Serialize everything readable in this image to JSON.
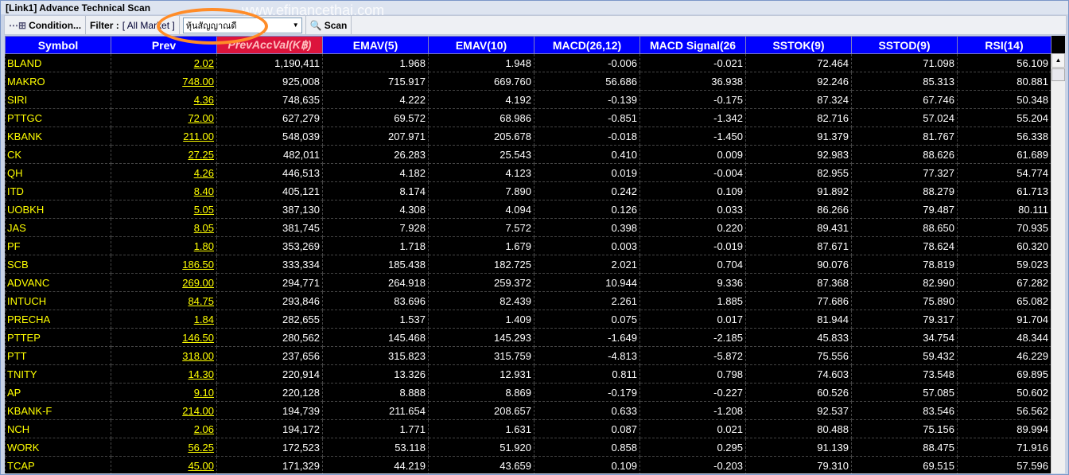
{
  "window": {
    "title": "[Link1] Advance Technical Scan",
    "watermark": "www.efinancethai.com"
  },
  "toolbar": {
    "condition_label": "Condition...",
    "filter_label": "Filter :",
    "filter_value": "[ All Market ]",
    "combo_value": "หุ้นสัญญาณดี",
    "scan_label": "Scan"
  },
  "colors": {
    "header": "#0000ff",
    "sorted_header": "#dc143c",
    "symbol": "#ffff00",
    "annotation": "#ff8c28"
  },
  "columns": [
    "Symbol",
    "Prev",
    "PrevAccVal(K฿)",
    "EMAV(5)",
    "EMAV(10)",
    "MACD(26,12)",
    "MACD Signal(26",
    "SSTOK(9)",
    "SSTOD(9)",
    "RSI(14)"
  ],
  "rows": [
    [
      "BLAND",
      "2.02",
      "1,190,411",
      "1.968",
      "1.948",
      "-0.006",
      "-0.021",
      "72.464",
      "71.098",
      "56.109"
    ],
    [
      "MAKRO",
      "748.00",
      "925,008",
      "715.917",
      "669.760",
      "56.686",
      "36.938",
      "92.246",
      "85.313",
      "80.881"
    ],
    [
      "SIRI",
      "4.36",
      "748,635",
      "4.222",
      "4.192",
      "-0.139",
      "-0.175",
      "87.324",
      "67.746",
      "50.348"
    ],
    [
      "PTTGC",
      "72.00",
      "627,279",
      "69.572",
      "68.986",
      "-0.851",
      "-1.342",
      "82.716",
      "57.024",
      "55.204"
    ],
    [
      "KBANK",
      "211.00",
      "548,039",
      "207.971",
      "205.678",
      "-0.018",
      "-1.450",
      "91.379",
      "81.767",
      "56.338"
    ],
    [
      "CK",
      "27.25",
      "482,011",
      "26.283",
      "25.543",
      "0.410",
      "0.009",
      "92.983",
      "88.626",
      "61.689"
    ],
    [
      "QH",
      "4.26",
      "446,513",
      "4.182",
      "4.123",
      "0.019",
      "-0.004",
      "82.955",
      "77.327",
      "54.774"
    ],
    [
      "ITD",
      "8.40",
      "405,121",
      "8.174",
      "7.890",
      "0.242",
      "0.109",
      "91.892",
      "88.279",
      "61.713"
    ],
    [
      "UOBKH",
      "5.05",
      "387,130",
      "4.308",
      "4.094",
      "0.126",
      "0.033",
      "86.266",
      "79.487",
      "80.111"
    ],
    [
      "JAS",
      "8.05",
      "381,745",
      "7.928",
      "7.572",
      "0.398",
      "0.220",
      "89.431",
      "88.650",
      "70.935"
    ],
    [
      "PF",
      "1.80",
      "353,269",
      "1.718",
      "1.679",
      "0.003",
      "-0.019",
      "87.671",
      "78.624",
      "60.320"
    ],
    [
      "SCB",
      "186.50",
      "333,334",
      "185.438",
      "182.725",
      "2.021",
      "0.704",
      "90.076",
      "78.819",
      "59.023"
    ],
    [
      "ADVANC",
      "269.00",
      "294,771",
      "264.918",
      "259.372",
      "10.944",
      "9.336",
      "87.368",
      "82.990",
      "67.282"
    ],
    [
      "INTUCH",
      "84.75",
      "293,846",
      "83.696",
      "82.439",
      "2.261",
      "1.885",
      "77.686",
      "75.890",
      "65.082"
    ],
    [
      "PRECHA",
      "1.84",
      "282,655",
      "1.537",
      "1.409",
      "0.075",
      "0.017",
      "81.944",
      "79.317",
      "91.704"
    ],
    [
      "PTTEP",
      "146.50",
      "280,562",
      "145.468",
      "145.293",
      "-1.649",
      "-2.185",
      "45.833",
      "34.754",
      "48.344"
    ],
    [
      "PTT",
      "318.00",
      "237,656",
      "315.823",
      "315.759",
      "-4.813",
      "-5.872",
      "75.556",
      "59.432",
      "46.229"
    ],
    [
      "TNITY",
      "14.30",
      "220,914",
      "13.326",
      "12.931",
      "0.811",
      "0.798",
      "74.603",
      "73.548",
      "69.895"
    ],
    [
      "AP",
      "9.10",
      "220,128",
      "8.888",
      "8.869",
      "-0.179",
      "-0.227",
      "60.526",
      "57.085",
      "50.602"
    ],
    [
      "KBANK-F",
      "214.00",
      "194,739",
      "211.654",
      "208.657",
      "0.633",
      "-1.208",
      "92.537",
      "83.546",
      "56.562"
    ],
    [
      "NCH",
      "2.06",
      "194,172",
      "1.771",
      "1.631",
      "0.087",
      "0.021",
      "80.488",
      "75.156",
      "89.994"
    ],
    [
      "WORK",
      "56.25",
      "172,523",
      "53.118",
      "51.920",
      "0.858",
      "0.295",
      "91.139",
      "88.475",
      "71.916"
    ],
    [
      "TCAP",
      "45.00",
      "171,329",
      "44.219",
      "43.659",
      "0.109",
      "-0.203",
      "79.310",
      "69.515",
      "57.596"
    ]
  ]
}
